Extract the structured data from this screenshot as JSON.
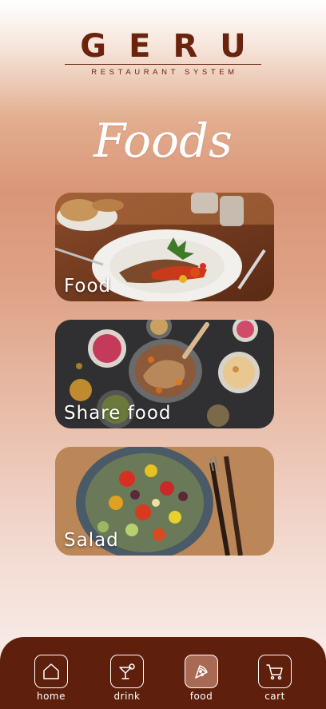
{
  "brand": {
    "title": "GERU",
    "subtitle": "RESTAURANT SYSTEM"
  },
  "page": {
    "title": "Foods"
  },
  "categories": [
    {
      "label": "Food"
    },
    {
      "label": "Share food"
    },
    {
      "label": "Salad"
    }
  ],
  "tabbar": {
    "tabs": [
      {
        "label": "home",
        "icon": "home-icon"
      },
      {
        "label": "drink",
        "icon": "cocktail-icon"
      },
      {
        "label": "food",
        "icon": "pizza-slice-icon",
        "active": true
      },
      {
        "label": "cart",
        "icon": "cart-icon"
      }
    ]
  },
  "colors": {
    "brand": "#6a240e",
    "tabbar": "#5e200c",
    "active_tab": "#a86a55"
  }
}
